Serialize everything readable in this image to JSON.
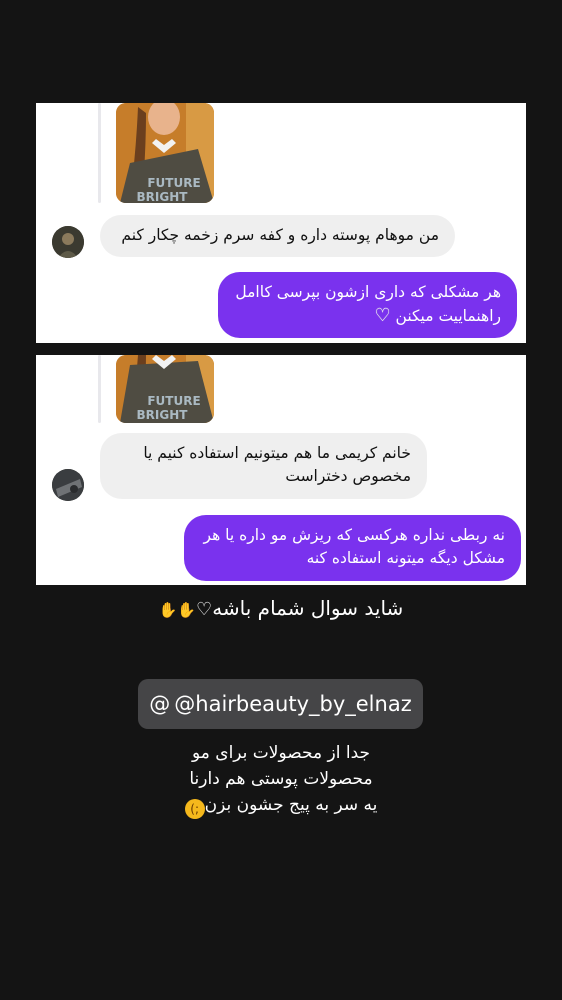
{
  "story": {
    "card1": {
      "incoming_message": "من موهام پوسته داره و کفه سرم زخمه چکار کنم",
      "outgoing_message": "هر مشکلی که داری ازشون بپرسی کاامل راهنماییت میکنن"
    },
    "card2": {
      "incoming_message": "خانم کریمی ما هم میتونیم استفاده کنیم یا مخصوص دختراست",
      "outgoing_message": "نه ربطی نداره هرکسی که ریزش مو داره یا هر مشکل دیگه میتونه استفاده کنه"
    },
    "caption_top": "شاید سوال شمام باشه",
    "mention_handle": "@hairbeauty_by_elnaz",
    "caption_lines": [
      "جدا از محصولات برای مو",
      "محصولات پوستی هم دارنا",
      "یه سر به پیج جشون بزن"
    ]
  },
  "colors": {
    "background": "#141414",
    "outgoing_bubble": "#7a32ee",
    "incoming_bubble": "#efefef",
    "mention_sticker": "#454547"
  },
  "icons": [
    "white-heart-icon",
    "raised-hands-icon",
    "threads-icon",
    "winking-face-icon"
  ]
}
